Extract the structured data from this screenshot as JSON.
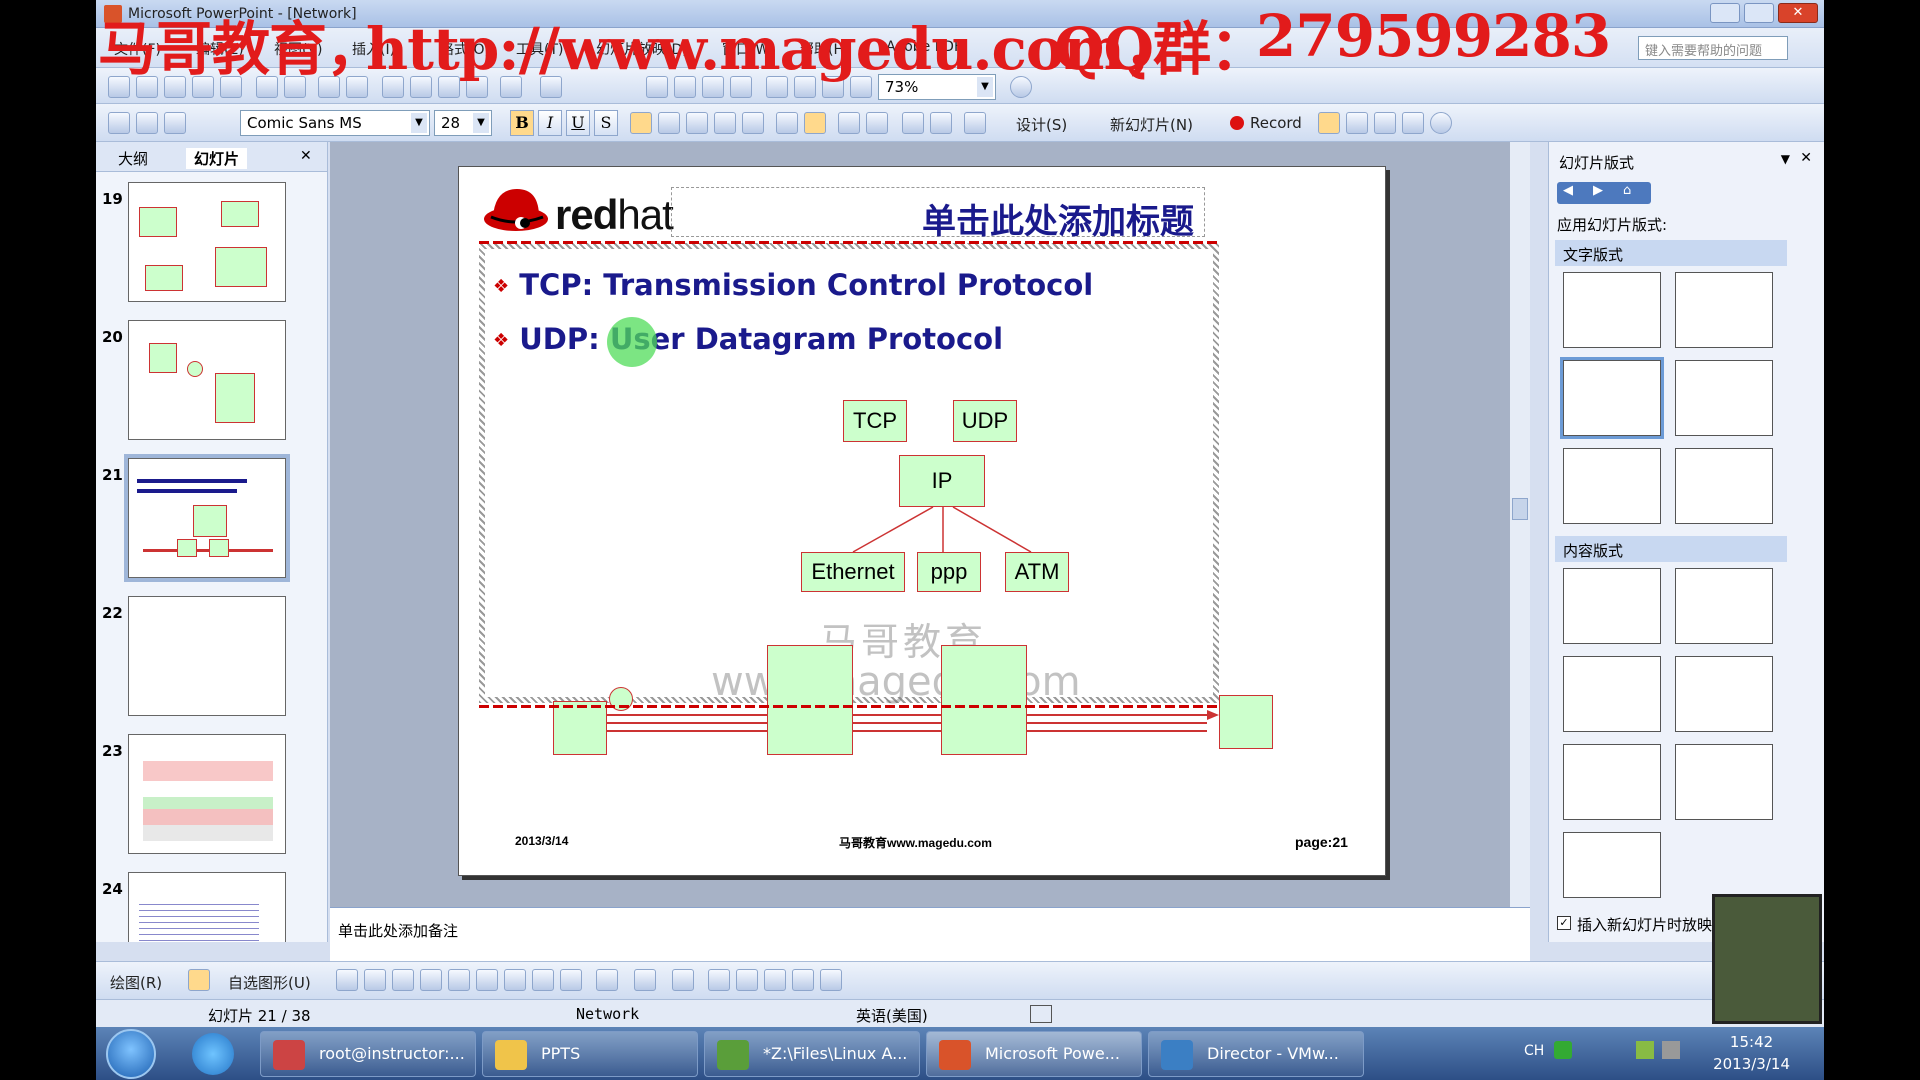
{
  "window": {
    "title": "Microsoft PowerPoint - [Network]"
  },
  "watermark": {
    "brand": "马哥教育，",
    "url": "http://www.magedu.com，",
    "qq": "QQ群：",
    "qq_number": "279599283"
  },
  "menu": [
    "文件(F)",
    "编辑(E)",
    "视图(V)",
    "插入(I)",
    "格式(O)",
    "工具(T)",
    "幻灯片放映(D)",
    "窗口(W)",
    "帮助(H)",
    "Adobe PDF"
  ],
  "help_box": {
    "placeholder": "键入需要帮助的问题"
  },
  "toolbar": {
    "zoom": "73%",
    "font": "Comic Sans MS",
    "font_size": "28",
    "design_label": "设计(S)",
    "new_slide_label": "新幻灯片(N)",
    "record_label": "Record"
  },
  "left_pane": {
    "tab_outline": "大纲",
    "tab_slides": "幻灯片",
    "slide_numbers": [
      "19",
      "20",
      "21",
      "22",
      "23",
      "24"
    ],
    "selected": "21"
  },
  "slide": {
    "title_placeholder": "单击此处添加标题",
    "bullets": [
      "TCP: Transmission Control Protocol",
      "UDP: User Datagram Protocol"
    ],
    "brand_text": "red",
    "brand_text2": "hat",
    "diagram": {
      "top_left": "TCP",
      "top_right": "UDP",
      "middle": "IP",
      "bottom": [
        "Ethernet",
        "ppp",
        "ATM"
      ]
    },
    "watermark_cn": "马哥教育",
    "watermark_url": "www.magedu.com",
    "footer_date": "2013/3/14",
    "footer_center": "马哥教育www.magedu.com",
    "footer_page": "page:21"
  },
  "notes": {
    "placeholder": "单击此处添加备注"
  },
  "right_pane": {
    "title": "幻灯片版式",
    "apply_label": "应用幻灯片版式:",
    "section_text": "文字版式",
    "section_content": "内容版式",
    "checkbox_label": "插入新幻灯片时放映"
  },
  "drawbar": {
    "draw_label": "绘图(R)",
    "autoshape_label": "自选图形(U)"
  },
  "status": {
    "slide": "幻灯片 21 / 38",
    "design": "Network",
    "language": "英语(美国)"
  },
  "taskbar": {
    "items": [
      "root@instructor:...",
      "PPTS",
      "*Z:\\Files\\Linux A...",
      "Microsoft Powe...",
      "Director - VMw..."
    ],
    "time": "15:42",
    "date": "2013/3/14",
    "lang": "CH"
  },
  "colors": {
    "accent_red": "#cc0000",
    "diagram_fill": "#ccffcc",
    "text_blue": "#1a1a8c"
  }
}
